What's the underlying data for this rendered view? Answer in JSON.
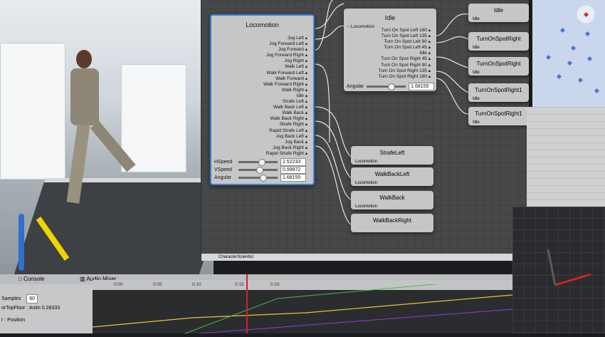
{
  "graph": {
    "locomotion_node": {
      "title": "Locomotion",
      "ports": [
        "Jog Left",
        "Jog Forward Left",
        "Jog Forward",
        "Jog Forward Right",
        "Jog Right",
        "Walk Left",
        "Walk Forward Left",
        "Walk Forward",
        "Walk Forward Right",
        "Walk Right",
        "Idle",
        "Strafe Left",
        "Walk Back Left",
        "Walk Back",
        "Walk Back Right",
        "Strafe Right",
        "Rapid Strafe Left",
        "Jog Back Left",
        "Jog Back",
        "Jog Back Right",
        "Rapid Strafe Right"
      ],
      "params": [
        {
          "label": "HSpeed",
          "value": "2.52233",
          "fraction": 0.5
        },
        {
          "label": "VSpeed",
          "value": "0.99872",
          "fraction": 0.45
        },
        {
          "label": "Angular",
          "value": "1.68155",
          "fraction": 0.55
        }
      ]
    },
    "idle_node": {
      "title": "Idle",
      "input": "Locomotion",
      "ports": [
        "Turn On Spot Left 180",
        "Turn On Spot Left 135",
        "Turn On Spot Left 90",
        "Turn On Spot Left 45",
        "Idle",
        "Turn On Spot Right 45",
        "Turn On Spot Right 90",
        "Turn On Spot Right 135",
        "Turn On Spot Right 180"
      ],
      "param_label": "Angular",
      "param_value": "1.68155"
    },
    "small_nodes": [
      {
        "title": "StrafeLeft",
        "port": "Locomotion"
      },
      {
        "title": "WalkBackLeft",
        "port": "Locomotion"
      },
      {
        "title": "WalkBack",
        "port": "Locomotion"
      },
      {
        "title": "WalkBackRight",
        "port": ""
      }
    ],
    "right_nodes": [
      {
        "title": "Idle",
        "port": "Idle"
      },
      {
        "title": "TurnOnSpotRight",
        "port": "Idle"
      },
      {
        "title": "TurnOnSpotRight",
        "port": "Idle"
      },
      {
        "title": "TurnOnSpotRight1",
        "port": "Idle"
      },
      {
        "title": "TurnOnSpotRight1",
        "port": "Idle"
      }
    ],
    "footer": "CharacterScientist"
  },
  "timeline": {
    "tabs": [
      "Console",
      "Audio Mixer"
    ],
    "ruler_ticks": [
      "0:00",
      "0:05",
      "0:10",
      "0:15",
      "0:20"
    ],
    "samples_label": "Samples",
    "samples_value": "60",
    "rows": [
      "orTopFloor : Anim 0.28333",
      "r : Position"
    ]
  },
  "colors": {
    "graph_bg": "#474849",
    "node_bg": "#c5c6c7",
    "selection": "#3b7fd6",
    "playhead": "#d2202a"
  }
}
